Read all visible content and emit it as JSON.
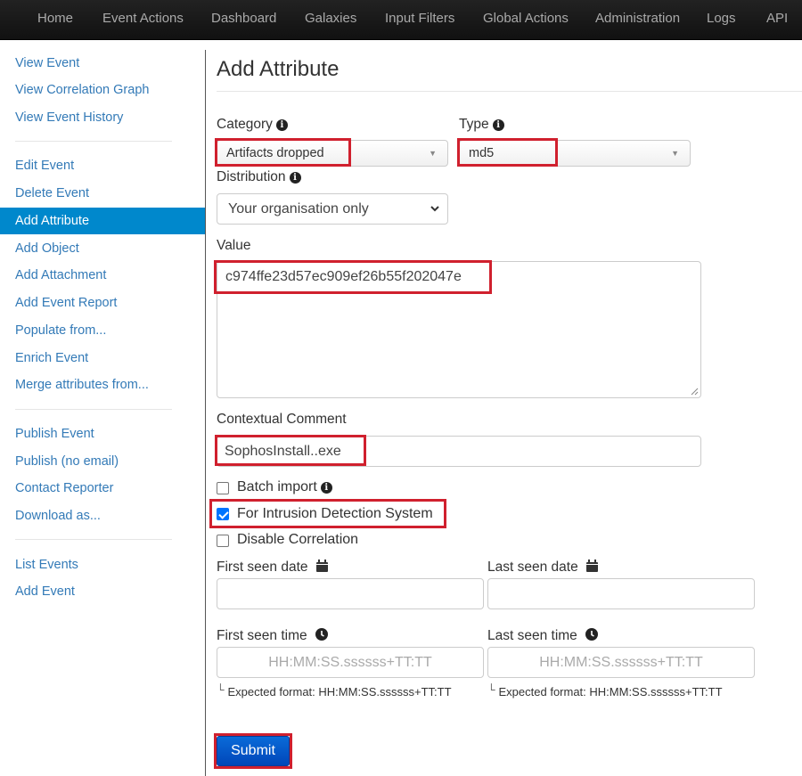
{
  "navbar": {
    "items": [
      "Home",
      "Event Actions",
      "Dashboard",
      "Galaxies",
      "Input Filters",
      "Global Actions",
      "Administration",
      "Logs",
      "API"
    ]
  },
  "sidebar": {
    "groups": [
      [
        "View Event",
        "View Correlation Graph",
        "View Event History"
      ],
      [
        "Edit Event",
        "Delete Event",
        "Add Attribute",
        "Add Object",
        "Add Attachment",
        "Add Event Report",
        "Populate from...",
        "Enrich Event",
        "Merge attributes from..."
      ],
      [
        "Publish Event",
        "Publish (no email)",
        "Contact Reporter",
        "Download as..."
      ],
      [
        "List Events",
        "Add Event"
      ]
    ],
    "active": "Add Attribute"
  },
  "main": {
    "title": "Add Attribute",
    "category": {
      "label": "Category",
      "value": "Artifacts dropped"
    },
    "type": {
      "label": "Type",
      "value": "md5"
    },
    "distribution": {
      "label": "Distribution",
      "value": "Your organisation only"
    },
    "value": {
      "label": "Value",
      "text": "c974ffe23d57ec909ef26b55f202047e"
    },
    "comment": {
      "label": "Contextual Comment",
      "text": "SophosInstall..exe"
    },
    "checkboxes": {
      "batch_import": {
        "label": "Batch import",
        "checked": false
      },
      "ids": {
        "label": "For Intrusion Detection System",
        "checked": true
      },
      "disable_correlation": {
        "label": "Disable Correlation",
        "checked": false
      }
    },
    "first_seen_date": {
      "label": "First seen date",
      "value": ""
    },
    "last_seen_date": {
      "label": "Last seen date",
      "value": ""
    },
    "first_seen_time": {
      "label": "First seen time",
      "placeholder": "HH:MM:SS.ssssss+TT:TT",
      "hint": "Expected format: HH:MM:SS.ssssss+TT:TT"
    },
    "last_seen_time": {
      "label": "Last seen time",
      "placeholder": "HH:MM:SS.ssssss+TT:TT",
      "hint": "Expected format: HH:MM:SS.ssssss+TT:TT"
    },
    "submit_label": "Submit"
  },
  "colors": {
    "highlight_box": "#d0202e",
    "sidebar_active": "#0088cc",
    "link": "#337ab7",
    "submit": "#0058c8"
  }
}
